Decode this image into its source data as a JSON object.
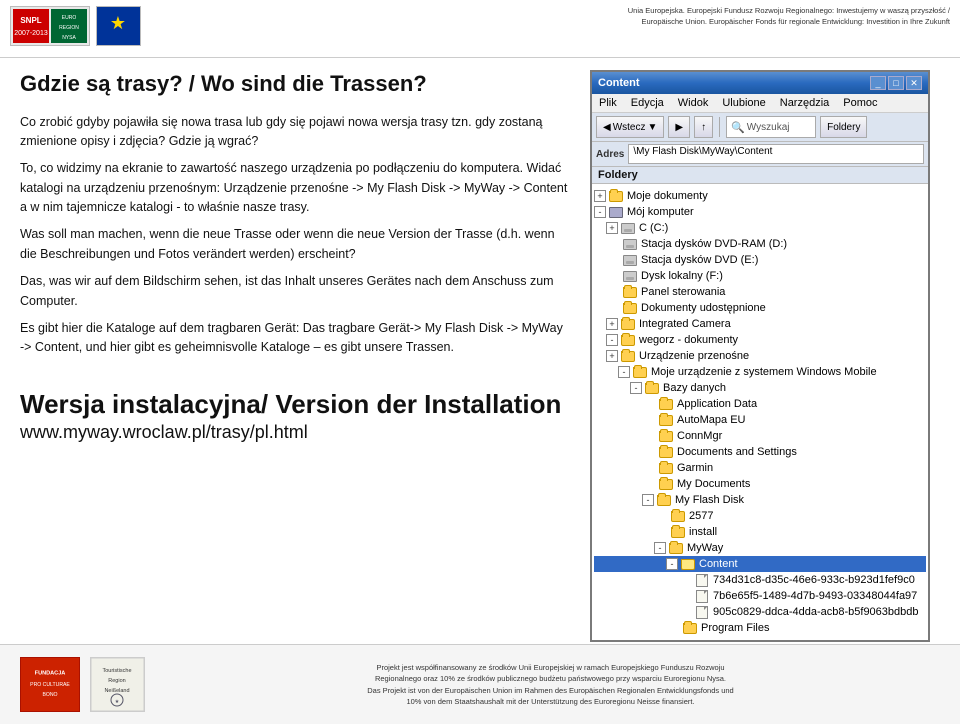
{
  "header": {
    "logo_snpl_text": "SNPL\n2007-2013",
    "logo_euroregion_text": "EUROREGION\nNEISSE-NISA-NYSA",
    "logo_eu_symbol": "★",
    "header_right_text": "Unia Europejska. Europejski Fundusz Rozwoju Regionalnego: Inwestujemy w waszą przyszłość / Europäische Union. Europäischer Fonds für regionale Entwicklung: Investition in Ihre Zukunft"
  },
  "main_title": "Gdzie są trasy? / Wo sind die Trassen?",
  "body_paragraphs": [
    "Co zrobić gdyby pojawiła się nowa trasa lub gdy się pojawi nowa wersja trasy tzn. gdy zostaną zmienione opisy i zdjęcia? Gdzie ją wgrać?",
    "To, co widzimy na ekranie to zawartość naszego urządzenia po podłączeniu do komputera. Widać katalogi na urządzeniu przenośnym: Urządzenie przenośne -> My Flash Disk -> MyWay -> Content a w nim tajemnicze katalogi - to właśnie nasze trasy.",
    "Was soll man machen, wenn die neue Trasse oder wenn die neue Version der Trasse (d.h. wenn die Beschreibungen und Fotos verändert werden) erscheint?",
    "Das, was wir auf dem Bildschirm  sehen, ist das Inhalt unseres Gerätes nach dem Anschuss zum Computer.",
    "Es gibt hier die Kataloge auf dem tragbaren Gerät: Das tragbare Gerät-> My Flash Disk -> MyWay -> Content, und hier gibt es geheimnisvolle Kataloge – es gibt unsere Trassen."
  ],
  "install_title": "Wersja instalacyjna/ Version der Installation",
  "install_url": "www.myway.wroclaw.pl/trasy/pl.html",
  "explorer": {
    "title": "Content",
    "menu_items": [
      "Plik",
      "Edycja",
      "Widok",
      "Ulubione",
      "Narzędzia",
      "Pomoc"
    ],
    "toolbar": {
      "back_label": "Wstecz",
      "forward_symbol": "▶",
      "up_symbol": "▲",
      "search_label": "Wyszukaj",
      "folders_label": "Foldery",
      "search_placeholder": "Wyszukaj"
    },
    "address_label": "Adres",
    "address_value": "\\My Flash Disk\\MyWay\\Content",
    "folder_label": "Foldery",
    "tree": [
      {
        "indent": 1,
        "expand": "+",
        "icon": "folder",
        "label": "Moje dokumenty",
        "level": 1
      },
      {
        "indent": 1,
        "expand": "-",
        "icon": "computer",
        "label": "Mój komputer",
        "level": 1
      },
      {
        "indent": 2,
        "expand": "+",
        "icon": "drive",
        "label": "C (C:)",
        "level": 2
      },
      {
        "indent": 2,
        "expand": " ",
        "icon": "drive",
        "label": "Stacja dysków DVD-RAM (D:)",
        "level": 2
      },
      {
        "indent": 2,
        "expand": " ",
        "icon": "drive",
        "label": "Stacja dysków DVD (E:)",
        "level": 2
      },
      {
        "indent": 2,
        "expand": " ",
        "icon": "drive",
        "label": "Dysk lokalny (F:)",
        "level": 2
      },
      {
        "indent": 2,
        "expand": " ",
        "icon": "folder",
        "label": "Panel sterowania",
        "level": 2
      },
      {
        "indent": 2,
        "expand": " ",
        "icon": "folder",
        "label": "Dokumenty udostępnione",
        "level": 2
      },
      {
        "indent": 2,
        "expand": "+",
        "icon": "folder",
        "label": "Integrated Camera",
        "level": 2
      },
      {
        "indent": 2,
        "expand": "-",
        "icon": "folder",
        "label": "wegorz - dokumenty",
        "level": 2
      },
      {
        "indent": 2,
        "expand": "+",
        "icon": "folder",
        "label": "Urządzenie przenośne",
        "level": 2
      },
      {
        "indent": 3,
        "expand": "-",
        "icon": "folder",
        "label": "Moje urządzenie z systemem Windows Mobile",
        "level": 3
      },
      {
        "indent": 4,
        "expand": "-",
        "icon": "folder",
        "label": "Bazy danych",
        "level": 4
      },
      {
        "indent": 5,
        "expand": " ",
        "icon": "folder",
        "label": "Application Data",
        "level": 5
      },
      {
        "indent": 5,
        "expand": " ",
        "icon": "folder",
        "label": "AutoMapa EU",
        "level": 5
      },
      {
        "indent": 5,
        "expand": " ",
        "icon": "folder",
        "label": "ConnMgr",
        "level": 5
      },
      {
        "indent": 5,
        "expand": " ",
        "icon": "folder",
        "label": "Documents and Settings",
        "level": 5
      },
      {
        "indent": 5,
        "expand": " ",
        "icon": "folder",
        "label": "Garmin",
        "level": 5
      },
      {
        "indent": 5,
        "expand": " ",
        "icon": "folder",
        "label": "My Documents",
        "level": 5
      },
      {
        "indent": 5,
        "expand": "-",
        "icon": "folder",
        "label": "My Flash Disk",
        "level": 5
      },
      {
        "indent": 6,
        "expand": " ",
        "icon": "folder",
        "label": "2577",
        "level": 6
      },
      {
        "indent": 6,
        "expand": " ",
        "icon": "folder",
        "label": "install",
        "level": 6
      },
      {
        "indent": 6,
        "expand": "-",
        "icon": "folder",
        "label": "MyWay",
        "level": 6
      },
      {
        "indent": 7,
        "expand": "-",
        "icon": "folder-open",
        "label": "Content",
        "level": 7,
        "selected": true
      },
      {
        "indent": 8,
        "expand": " ",
        "icon": "file",
        "label": "734d31c8-d35c-46e6-933c-b923d1fef9c0",
        "level": 8
      },
      {
        "indent": 8,
        "expand": " ",
        "icon": "file",
        "label": "7b6e65f5-1489-4d7b-9493-03348044fa97",
        "level": 8
      },
      {
        "indent": 8,
        "expand": " ",
        "icon": "file",
        "label": "905c0829-ddca-4dda-acb8-b5f9063bdbdb",
        "level": 8
      },
      {
        "indent": 7,
        "expand": " ",
        "icon": "folder",
        "label": "Program Files",
        "level": 7
      }
    ]
  },
  "footer": {
    "logo1_text": "FUNDACJA\nPRO CULTURAE BONO",
    "logo2_text": "Touristische\nRegion\nNeißeland",
    "footer_text_line1": "Projekt jest współfinansowany ze środków Unii Europejskiej w ramach Europejskiego Funduszu Rozwoju",
    "footer_text_line2": "Regionalnego oraz 10% ze środków publicznego budżetu państwowego przy wsparciu Euroregionu Nysa.",
    "footer_text_line3": "Das Projekt ist von der Europäischen Union im Rahmen des Europäischen Regionalen Entwicklungsfonds und",
    "footer_text_line4": "10% von dem Staatshaushalt mit der Unterstützung des Euroregionu Neisse finansiert."
  }
}
